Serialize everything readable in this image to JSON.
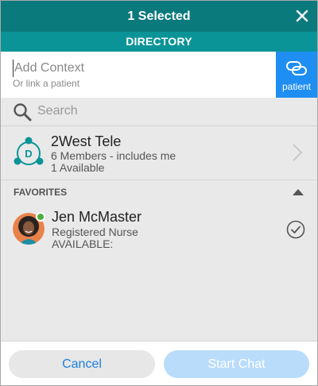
{
  "header": {
    "title": "1 Selected",
    "close_icon": "close-icon",
    "background": "#0b7a7c"
  },
  "subheader": {
    "title": "DIRECTORY",
    "background": "#0a9498"
  },
  "context": {
    "placeholder": "Add Context",
    "sublabel": "Or link a patient",
    "patient_button": {
      "label": "patient",
      "icon": "link-icon",
      "background": "#1e8ef2"
    }
  },
  "search": {
    "placeholder": "Search",
    "icon": "search-icon"
  },
  "group": {
    "avatar_letter": "D",
    "name": "2West Tele",
    "members": "6 Members - includes me",
    "available": "1 Available",
    "icon": "chevron-right-icon"
  },
  "favorites": {
    "label": "FAVORITES",
    "collapse_icon": "caret-up-icon",
    "items": [
      {
        "name": "Jen McMaster",
        "role": "Registered Nurse",
        "status": "AVAILABLE:",
        "presence": "available",
        "selected": true,
        "selected_icon": "checkmark-circle-icon"
      }
    ]
  },
  "footer": {
    "cancel_label": "Cancel",
    "start_label": "Start Chat",
    "accent": "#1e7fe0"
  }
}
